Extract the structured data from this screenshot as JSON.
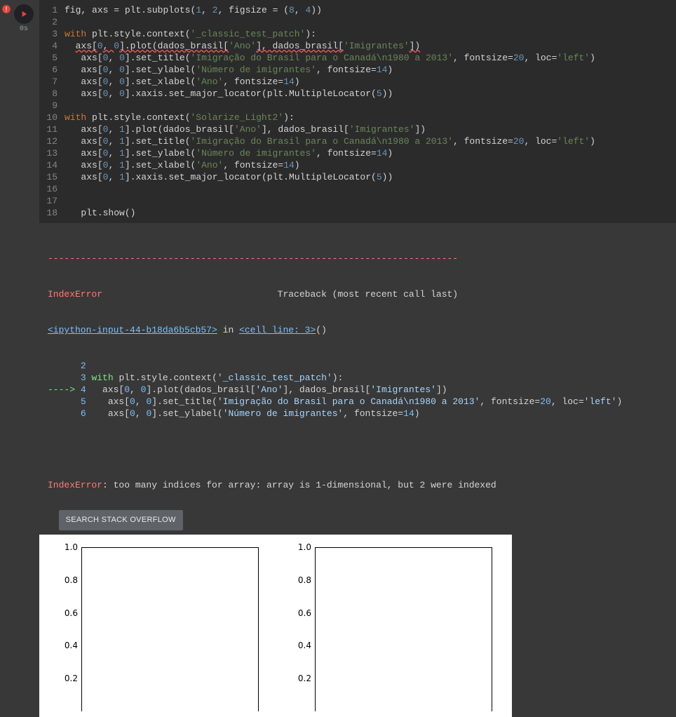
{
  "exec_label": "0s",
  "code_lines": [
    {
      "n": 1,
      "html": "fig<span class='c-op'>,</span> axs <span class='c-op'>=</span> plt<span class='c-op'>.</span>subplots<span class='c-paren'>(</span><span class='c-num'>1</span><span class='c-op'>,</span> <span class='c-num'>2</span><span class='c-op'>,</span> figsize <span class='c-op'>=</span> <span class='c-paren'>(</span><span class='c-num'>8</span><span class='c-op'>,</span> <span class='c-num'>4</span><span class='c-paren'>))</span>"
    },
    {
      "n": 2,
      "html": ""
    },
    {
      "n": 3,
      "html": "<span class='c-kw'>with</span> plt<span class='c-op'>.</span>style<span class='c-op'>.</span>context<span class='c-paren'>(</span><span class='c-str'>'_classic_test_patch'</span><span class='c-paren'>)</span><span class='c-op'>:</span>"
    },
    {
      "n": 4,
      "html": "  <span class='underline-err'>axs[</span><span class='c-num'>0</span><span class='underline-err'>, </span><span class='c-num'>0</span><span class='underline-err'>].plot(dados_brasil[</span><span class='c-str'>'Ano'</span><span class='underline-err'>], dados_brasil[</span><span class='c-str'>'Imigrantes'</span><span class='underline-err'>])</span>"
    },
    {
      "n": 5,
      "html": "   axs<span class='c-paren'>[</span><span class='c-num'>0</span><span class='c-op'>,</span> <span class='c-num'>0</span><span class='c-paren'>]</span><span class='c-op'>.</span>set_title<span class='c-paren'>(</span><span class='c-str'>'Imigração do Brasil para o Canadá\\n1980 a 2013'</span><span class='c-op'>,</span> fontsize<span class='c-op'>=</span><span class='c-num'>20</span><span class='c-op'>,</span> loc<span class='c-op'>=</span><span class='c-str'>'left'</span><span class='c-paren'>)</span>"
    },
    {
      "n": 6,
      "html": "   axs<span class='c-paren'>[</span><span class='c-num'>0</span><span class='c-op'>,</span> <span class='c-num'>0</span><span class='c-paren'>]</span><span class='c-op'>.</span>set_ylabel<span class='c-paren'>(</span><span class='c-str'>'Número de imigrantes'</span><span class='c-op'>,</span> fontsize<span class='c-op'>=</span><span class='c-num'>14</span><span class='c-paren'>)</span>"
    },
    {
      "n": 7,
      "html": "   axs<span class='c-paren'>[</span><span class='c-num'>0</span><span class='c-op'>,</span> <span class='c-num'>0</span><span class='c-paren'>]</span><span class='c-op'>.</span>set_xlabel<span class='c-paren'>(</span><span class='c-str'>'Ano'</span><span class='c-op'>,</span> fontsize<span class='c-op'>=</span><span class='c-num'>14</span><span class='c-paren'>)</span>"
    },
    {
      "n": 8,
      "html": "   axs<span class='c-paren'>[</span><span class='c-num'>0</span><span class='c-op'>,</span> <span class='c-num'>0</span><span class='c-paren'>]</span><span class='c-op'>.</span>xaxis<span class='c-op'>.</span>set_major_locator<span class='c-paren'>(</span>plt<span class='c-op'>.</span>MultipleLocator<span class='c-paren'>(</span><span class='c-num'>5</span><span class='c-paren'>))</span>"
    },
    {
      "n": 9,
      "html": ""
    },
    {
      "n": 10,
      "html": "<span class='c-kw'>with</span> plt<span class='c-op'>.</span>style<span class='c-op'>.</span>context<span class='c-paren'>(</span><span class='c-str'>'Solarize_Light2'</span><span class='c-paren'>)</span><span class='c-op'>:</span>"
    },
    {
      "n": 11,
      "html": "   axs<span class='c-paren'>[</span><span class='c-num'>0</span><span class='c-op'>,</span> <span class='c-num'>1</span><span class='c-paren'>]</span><span class='c-op'>.</span>plot<span class='c-paren'>(</span>dados_brasil<span class='c-paren'>[</span><span class='c-str'>'Ano'</span><span class='c-paren'>]</span><span class='c-op'>,</span> dados_brasil<span class='c-paren'>[</span><span class='c-str'>'Imigrantes'</span><span class='c-paren'>])</span>"
    },
    {
      "n": 12,
      "html": "   axs<span class='c-paren'>[</span><span class='c-num'>0</span><span class='c-op'>,</span> <span class='c-num'>1</span><span class='c-paren'>]</span><span class='c-op'>.</span>set_title<span class='c-paren'>(</span><span class='c-str'>'Imigração do Brasil para o Canadá\\n1980 a 2013'</span><span class='c-op'>,</span> fontsize<span class='c-op'>=</span><span class='c-num'>20</span><span class='c-op'>,</span> loc<span class='c-op'>=</span><span class='c-str'>'left'</span><span class='c-paren'>)</span>"
    },
    {
      "n": 13,
      "html": "   axs<span class='c-paren'>[</span><span class='c-num'>0</span><span class='c-op'>,</span> <span class='c-num'>1</span><span class='c-paren'>]</span><span class='c-op'>.</span>set_ylabel<span class='c-paren'>(</span><span class='c-str'>'Número de imigrantes'</span><span class='c-op'>,</span> fontsize<span class='c-op'>=</span><span class='c-num'>14</span><span class='c-paren'>)</span>"
    },
    {
      "n": 14,
      "html": "   axs<span class='c-paren'>[</span><span class='c-num'>0</span><span class='c-op'>,</span> <span class='c-num'>1</span><span class='c-paren'>]</span><span class='c-op'>.</span>set_xlabel<span class='c-paren'>(</span><span class='c-str'>'Ano'</span><span class='c-op'>,</span> fontsize<span class='c-op'>=</span><span class='c-num'>14</span><span class='c-paren'>)</span>"
    },
    {
      "n": 15,
      "html": "   axs<span class='c-paren'>[</span><span class='c-num'>0</span><span class='c-op'>,</span> <span class='c-num'>1</span><span class='c-paren'>]</span><span class='c-op'>.</span>xaxis<span class='c-op'>.</span>set_major_locator<span class='c-paren'>(</span>plt<span class='c-op'>.</span>MultipleLocator<span class='c-paren'>(</span><span class='c-num'>5</span><span class='c-paren'>))</span>"
    },
    {
      "n": 16,
      "html": ""
    },
    {
      "n": 17,
      "html": ""
    },
    {
      "n": 18,
      "html": "   plt<span class='c-op'>.</span>show<span class='c-paren'>()</span>"
    }
  ],
  "traceback": {
    "dash_line": "---------------------------------------------------------------------------",
    "error_header_name": "IndexError",
    "error_header_trace": "                                Traceback (most recent call last)",
    "input_link": "<ipython-input-44-b18da6b5cb57>",
    "in_text": " in ",
    "cell_line": "<cell line: 3>",
    "cell_suffix": "()",
    "lines": [
      {
        "no": "2",
        "prefix": "      ",
        "body": ""
      },
      {
        "no": "3",
        "prefix": "      ",
        "body": "<span class='err-kw'>with</span> plt.style.context(<span class='err-str'>'_classic_test_patch'</span>):"
      },
      {
        "no": "4",
        "prefix": "<span class='arrow'>----&gt; </span>",
        "body": "  axs[<span class='err-num'>0</span>, <span class='err-num'>0</span>].plot(dados_brasil[<span class='err-str'>'Ano'</span>], dados_brasil[<span class='err-str'>'Imigrantes'</span>])"
      },
      {
        "no": "5",
        "prefix": "      ",
        "body": "   axs[<span class='err-num'>0</span>, <span class='err-num'>0</span>].set_title(<span class='err-str'>'Imigração do Brasil para o Canadá\\n1980 a 2013'</span>, fontsize=<span class='err-num'>20</span>, loc=<span class='err-str'>'left'</span>)"
      },
      {
        "no": "6",
        "prefix": "      ",
        "body": "   axs[<span class='err-num'>0</span>, <span class='err-num'>0</span>].set_ylabel(<span class='err-str'>'Número de imigrantes'</span>, fontsize=<span class='err-num'>14</span>)"
      }
    ],
    "final_name": "IndexError",
    "final_msg": ": too many indices for array: array is 1-dimensional, but 2 were indexed"
  },
  "so_button_label": "SEARCH STACK OVERFLOW",
  "chart_data": [
    {
      "type": "line",
      "title": "",
      "xlabel": "",
      "ylabel": "",
      "yticks": [
        1.0,
        0.8,
        0.6,
        0.4,
        0.2
      ],
      "ylim": [
        0,
        1
      ],
      "series": []
    },
    {
      "type": "line",
      "title": "",
      "xlabel": "",
      "ylabel": "",
      "yticks": [
        1.0,
        0.8,
        0.6,
        0.4,
        0.2
      ],
      "ylim": [
        0,
        1
      ],
      "series": []
    }
  ]
}
